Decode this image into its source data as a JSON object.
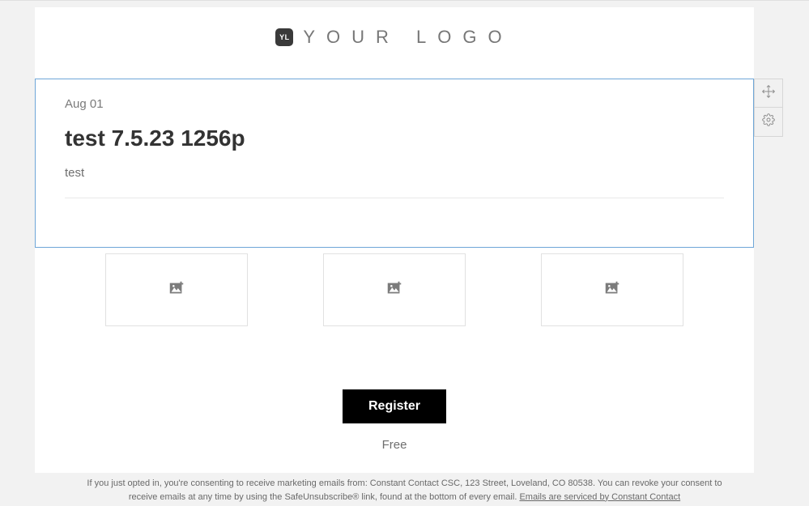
{
  "logo": {
    "badge": "YL",
    "text": "YOUR LOGO"
  },
  "event": {
    "date": "Aug 01",
    "title": "test 7.5.23 1256p",
    "description": "test"
  },
  "register": {
    "button_label": "Register",
    "price": "Free"
  },
  "footer": {
    "line1": "If you just opted in, you're consenting to receive marketing emails from: Constant Contact CSC, 123 Street, Loveland, CO 80538. You can revoke your consent to",
    "line2_pre": "receive emails at any time by using the SafeUnsubscribe® link, found at the bottom of every email. ",
    "link_text": "Emails are serviced by Constant Contact"
  }
}
